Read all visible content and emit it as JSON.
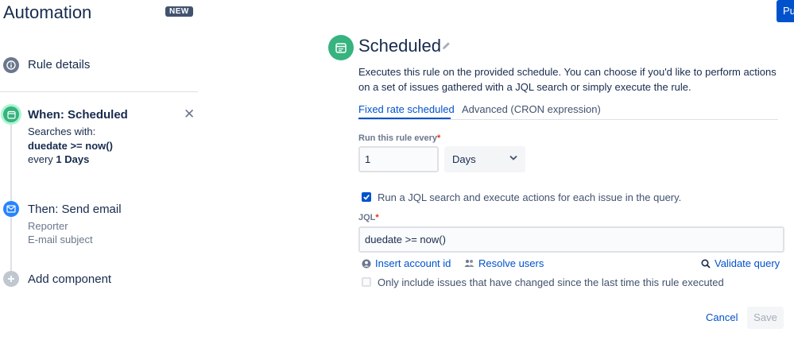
{
  "app": {
    "title": "Automation",
    "badge": "NEW",
    "publish_label": "Publish rule"
  },
  "sidebar": {
    "rule_details": "Rule details",
    "trigger": {
      "title": "When: Scheduled",
      "line1": "Searches with:",
      "line2": "duedate >= now()",
      "line3_prefix": "every ",
      "line3_value": "1 Days"
    },
    "action": {
      "title": "Then: Send email",
      "line1": "Reporter",
      "line2": "E-mail subject"
    },
    "add_component": "Add component"
  },
  "panel": {
    "title": "Scheduled",
    "description": "Executes this rule on the provided schedule. You can choose if you'd like to perform actions on a set of issues gathered with a JQL search or simply execute the rule.",
    "tabs": [
      {
        "label": "Fixed rate scheduled",
        "active": true
      },
      {
        "label": "Advanced (CRON expression)",
        "active": false
      }
    ],
    "run_every": {
      "label": "Run this rule every",
      "required": "*",
      "value": "1"
    },
    "unit_select": {
      "selected": "Days"
    },
    "jql_checkbox": {
      "checked": true,
      "label": "Run a JQL search and execute actions for each issue in the query."
    },
    "jql": {
      "label": "JQL",
      "required": "*",
      "value": "duedate >= now()"
    },
    "links": {
      "insert_account": "Insert account id",
      "resolve_users": "Resolve users",
      "validate_query": "Validate query"
    },
    "changed_checkbox": {
      "checked": false,
      "label": "Only include issues that have changed since the last time this rule executed"
    },
    "buttons": {
      "cancel": "Cancel",
      "save": "Save"
    }
  },
  "colors": {
    "accent": "#0052cc",
    "trigger_green": "#36b37e",
    "action_blue": "#2684ff",
    "required_red": "#de350b"
  }
}
